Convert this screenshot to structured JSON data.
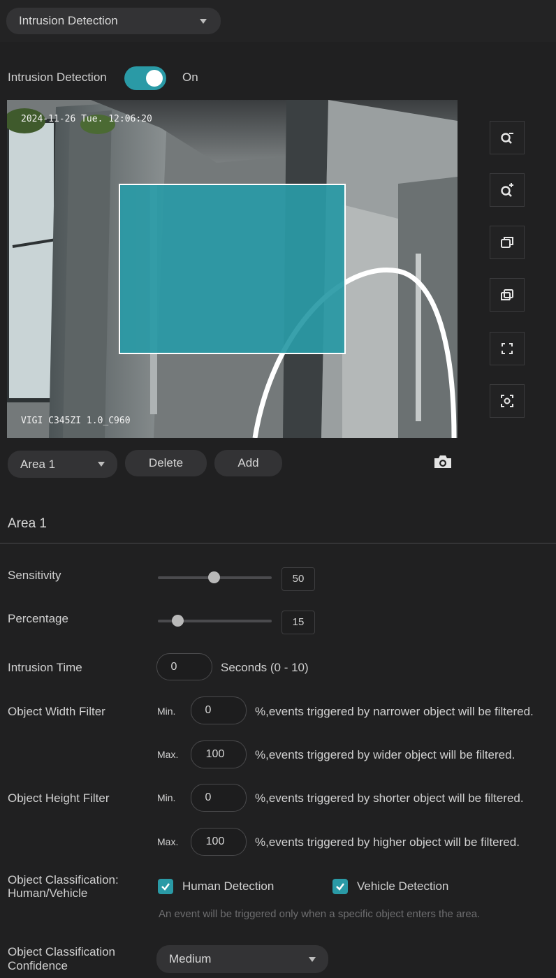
{
  "top_select": {
    "value": "Intrusion Detection"
  },
  "toggle": {
    "label": "Intrusion Detection",
    "state": "On",
    "on": true
  },
  "video": {
    "timestamp": "2024-11-26 Tue. 12:06:20",
    "camera_label": "VIGI C345ZI 1.0_C960"
  },
  "tools": [
    "zoom-out-icon",
    "zoom-in-icon",
    "window-front-icon",
    "window-back-icon",
    "fullscreen-icon",
    "focus-icon"
  ],
  "area_bar": {
    "selected_area": "Area 1",
    "delete_label": "Delete",
    "add_label": "Add"
  },
  "section": {
    "title": "Area 1"
  },
  "sensitivity": {
    "label": "Sensitivity",
    "value": "50",
    "fraction": 0.5
  },
  "percentage": {
    "label": "Percentage",
    "value": "15",
    "fraction": 0.18
  },
  "intrusion_time": {
    "label": "Intrusion Time",
    "value": "0",
    "unit": "Seconds (0 - 10)"
  },
  "width_filter": {
    "label": "Object Width Filter",
    "min_label": "Min.",
    "min_value": "0",
    "min_desc": "%,events triggered by narrower object will be filtered.",
    "max_label": "Max.",
    "max_value": "100",
    "max_desc": "%,events triggered by wider object will be filtered."
  },
  "height_filter": {
    "label": "Object Height Filter",
    "min_label": "Min.",
    "min_value": "0",
    "min_desc": "%,events triggered by shorter object will be filtered.",
    "max_label": "Max.",
    "max_value": "100",
    "max_desc": "%,events triggered by higher object will be filtered."
  },
  "classification": {
    "label_line1": "Object Classification:",
    "label_line2": "Human/Vehicle",
    "human_label": "Human Detection",
    "vehicle_label": "Vehicle Detection",
    "hint": "An event will be triggered only when a specific object enters the area."
  },
  "confidence": {
    "label_line1": "Object Classification",
    "label_line2": "Confidence",
    "value": "Medium"
  },
  "colors": {
    "accent": "#2a9aa6",
    "background": "#202021"
  }
}
